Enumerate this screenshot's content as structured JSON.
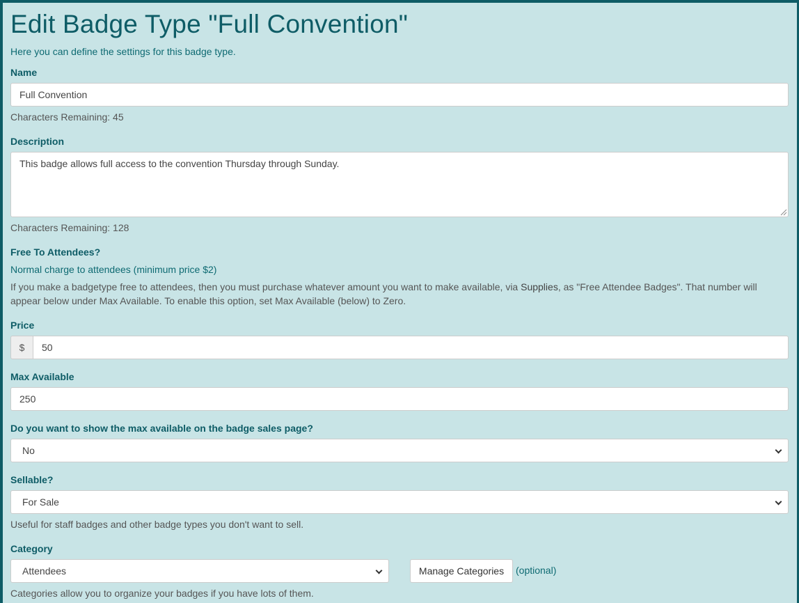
{
  "page": {
    "title": "Edit Badge Type \"Full Convention\"",
    "intro": "Here you can define the settings for this badge type."
  },
  "name": {
    "label": "Name",
    "value": "Full Convention",
    "chars_remaining": "Characters Remaining: 45"
  },
  "description": {
    "label": "Description",
    "value": "This badge allows full access to the convention Thursday through Sunday.",
    "chars_remaining": "Characters Remaining: 128"
  },
  "free": {
    "label": "Free To Attendees?",
    "value": "Normal charge to attendees (minimum price $2)",
    "help_pre": "If you make a badgetype free to attendees, then you must purchase whatever amount you want to make available, via ",
    "help_link": "Supplies",
    "help_mid": ", as \"Free Attendee Badges\". That number will",
    "help_line2": "appear below under Max Available. To enable this option, set Max Available (below) to Zero."
  },
  "price": {
    "label": "Price",
    "currency": "$",
    "value": "50"
  },
  "max_available": {
    "label": "Max Available",
    "value": "250"
  },
  "show_max": {
    "label": "Do you want to show the max available on the badge sales page?",
    "value": "No"
  },
  "sellable": {
    "label": "Sellable?",
    "value": "For Sale",
    "help": "Useful for staff badges and other badge types you don't want to sell."
  },
  "category": {
    "label": "Category",
    "value": "Attendees",
    "manage_button": "Manage Categories",
    "optional": "(optional)",
    "help": "Categories allow you to organize your badges if you have lots of them."
  }
}
